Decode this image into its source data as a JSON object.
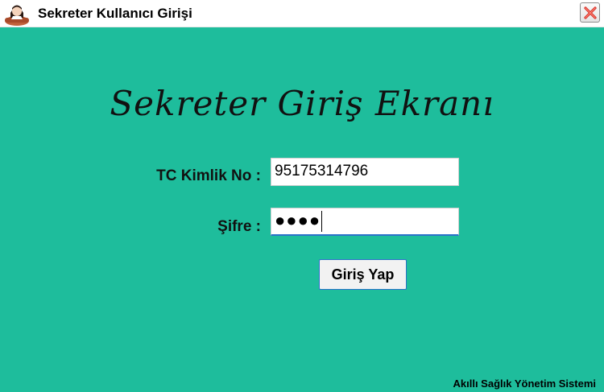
{
  "window": {
    "title": "Sekreter Kullanıcı Girişi",
    "app_icon": "secretary-avatar-icon",
    "close_icon": "close-x-icon"
  },
  "form": {
    "heading": "Sekreter Giriş Ekranı",
    "tc_label": "TC Kimlik No :",
    "tc_value": "95175314796",
    "password_label": "Şifre :",
    "password_mask": "●●●●",
    "login_button": "Giriş Yap"
  },
  "footer": {
    "text": "Akıllı Sağlık Yönetim Sistemi"
  },
  "colors": {
    "background": "#1ebd9c",
    "focus_accent": "#2a72c9",
    "close_red": "#d9322b"
  }
}
